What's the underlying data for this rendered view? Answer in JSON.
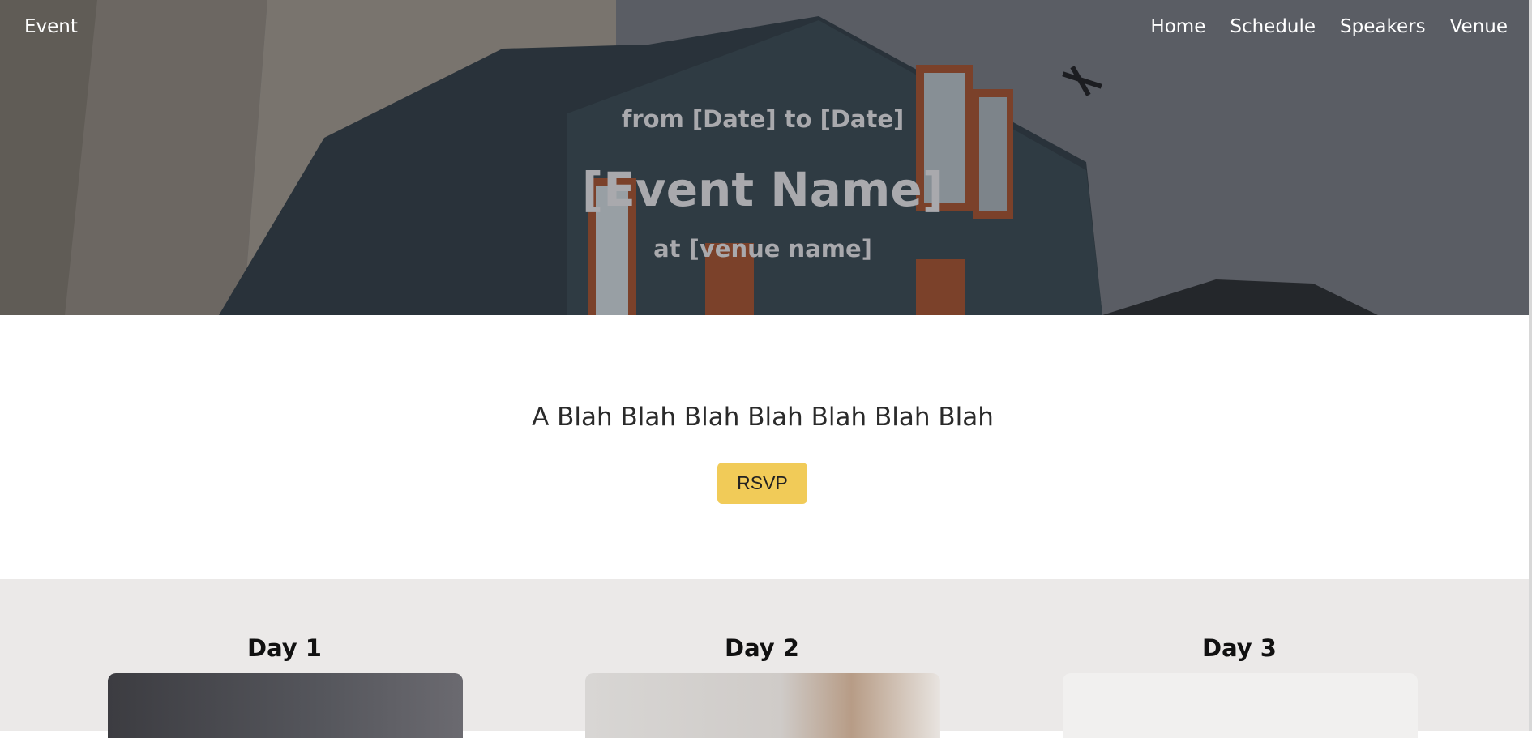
{
  "nav": {
    "brand": "Event",
    "links": [
      "Home",
      "Schedule",
      "Speakers",
      "Venue"
    ]
  },
  "hero": {
    "date_line": "from [Date] to [Date]",
    "event_name": "[Event Name]",
    "venue_line": "at [venue name]"
  },
  "intro": {
    "tagline": "A Blah Blah Blah Blah Blah Blah Blah",
    "rsvp_label": "RSVP"
  },
  "schedule": {
    "days": [
      "Day 1",
      "Day 2",
      "Day 3"
    ]
  },
  "colors": {
    "accent": "#f1cb58",
    "schedule_bg": "#ebe9e8",
    "hero_text": "#a9a9ad"
  }
}
